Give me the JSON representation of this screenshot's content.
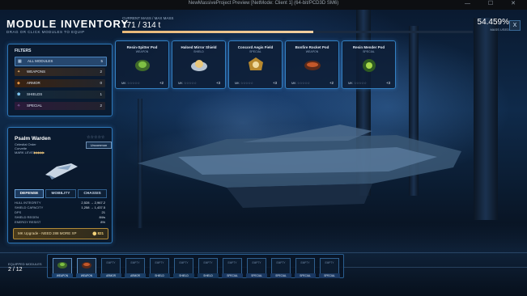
{
  "window": {
    "title": "NewMassiveProject Preview [NetMode: Client 1] (64-bit/PCD3D SM6)",
    "controls": "— ☐ ✕"
  },
  "header": {
    "title": "MODULE INVENTORY",
    "subtitle": "DRAG OR CLICK MODULES TO EQUIP",
    "mass_label": "CURRENT MASS / MAX MASS",
    "mass_value": "171 / 314 t",
    "mass_fraction": 0.545,
    "percent": "54.459%",
    "percent_label": "MASS USED",
    "close_label": "X"
  },
  "filters": {
    "title": "FILTERS",
    "items": [
      {
        "label": "ALL MODULES",
        "count": "5",
        "icon": "grid-icon"
      },
      {
        "label": "WEAPONS",
        "count": "2",
        "icon": "weapon-icon"
      },
      {
        "label": "ARMOR",
        "count": "0",
        "icon": "armor-icon"
      },
      {
        "label": "SHIELDS",
        "count": "1",
        "icon": "shield-icon"
      },
      {
        "label": "SPECIAL",
        "count": "2",
        "icon": "special-icon"
      }
    ]
  },
  "modules": [
    {
      "name": "Resin-Spitter Pod",
      "type": "WEAPON",
      "mk": "MK",
      "stars": "☆☆☆☆☆",
      "plus": "+2"
    },
    {
      "name": "Haloed Mirror Shield",
      "type": "SHIELD",
      "mk": "MK",
      "stars": "☆☆☆☆☆",
      "plus": "+3"
    },
    {
      "name": "Concord Aegis Field",
      "type": "SPECIAL",
      "mk": "MK",
      "stars": "☆☆☆☆☆",
      "plus": "+3"
    },
    {
      "name": "Bonfire Rocket Pod",
      "type": "WEAPON",
      "mk": "MK",
      "stars": "☆☆☆☆☆",
      "plus": "+2"
    },
    {
      "name": "Resin Mender Pod",
      "type": "SPECIAL",
      "mk": "MK",
      "stars": "☆☆☆☆☆",
      "plus": "+3"
    }
  ],
  "detail": {
    "name": "Psalm Warden",
    "subtitle1": "Celestial Order",
    "subtitle2": "Corvette",
    "mark_label": "MARK LEVEL",
    "mark_pips": "▶▶▶▶▶",
    "stars": "☆☆☆☆☆",
    "rarity": "Uncommon",
    "tabs": [
      "DEFENSE",
      "MOBILITY",
      "CHASSIS"
    ],
    "stats": [
      {
        "label": "HULL INTEGRITY",
        "value": "2,528 → 2,967.2"
      },
      {
        "label": "SHIELD CAPACITY",
        "value": "1,258 → 1,437.5"
      },
      {
        "label": "DPS",
        "value": "21"
      },
      {
        "label": "SHIELD REGEN",
        "value": "84/s"
      },
      {
        "label": "ENERGY RESIST",
        "value": "8%"
      }
    ],
    "upgrade_text": "MK Upgrade - NEED 288 MORE XP",
    "upgrade_cost": "⬤ 821"
  },
  "equipped": {
    "label": "EQUIPPED MODULES",
    "count": "2 / 12",
    "slots": [
      {
        "empty": "",
        "type": "WEAPON",
        "filled": true
      },
      {
        "empty": "",
        "type": "WEAPON",
        "filled": true
      },
      {
        "empty": "EMPTY",
        "type": "ARMOR",
        "filled": false
      },
      {
        "empty": "EMPTY",
        "type": "ARMOR",
        "filled": false
      },
      {
        "empty": "EMPTY",
        "type": "SHIELD",
        "filled": false
      },
      {
        "empty": "EMPTY",
        "type": "SHIELD",
        "filled": false
      },
      {
        "empty": "EMPTY",
        "type": "SHIELD",
        "filled": false
      },
      {
        "empty": "EMPTY",
        "type": "SPECIAL",
        "filled": false
      },
      {
        "empty": "EMPTY",
        "type": "SPECIAL",
        "filled": false
      },
      {
        "empty": "EMPTY",
        "type": "SPECIAL",
        "filled": false
      },
      {
        "empty": "EMPTY",
        "type": "SPECIAL",
        "filled": false
      },
      {
        "empty": "EMPTY",
        "type": "SPECIAL",
        "filled": false
      }
    ]
  },
  "colors": {
    "accent": "#2d77b8",
    "mass_bar": "#e8b878",
    "upgrade": "#b08a3a"
  }
}
